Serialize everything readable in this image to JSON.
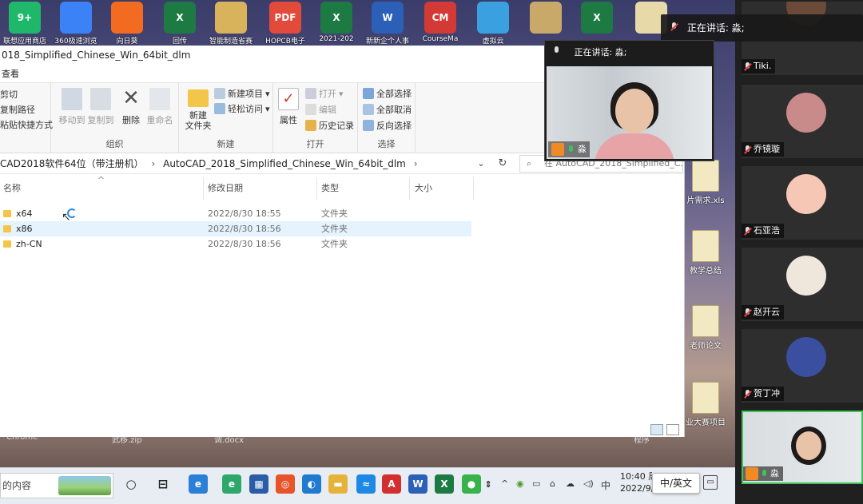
{
  "desktop_icons": [
    {
      "label": "联想应用商店",
      "color": "#1fb86a",
      "glyph": "9+"
    },
    {
      "label": "360极速浏览",
      "color": "#3b82f6",
      "glyph": ""
    },
    {
      "label": "向日葵",
      "color": "#f26b21",
      "glyph": ""
    },
    {
      "label": "回传",
      "color": "#1d7a43",
      "glyph": "X"
    },
    {
      "label": "智能制造省赛",
      "color": "#d9b25c",
      "glyph": ""
    },
    {
      "label": "HOPCB电子",
      "color": "#e24a3b",
      "glyph": "PDF"
    },
    {
      "label": "2021-202",
      "color": "#1d7a43",
      "glyph": "X"
    },
    {
      "label": "新新企个人事",
      "color": "#2b5fb8",
      "glyph": "W"
    },
    {
      "label": "CourseMa",
      "color": "#d33a36",
      "glyph": "CM"
    },
    {
      "label": "虚拟云",
      "color": "#3aa0e0",
      "glyph": ""
    },
    {
      "label": "",
      "color": "#c9a96a",
      "glyph": ""
    },
    {
      "label": "",
      "color": "#1d7a43",
      "glyph": "X"
    },
    {
      "label": "",
      "color": "#e8d9a8",
      "glyph": ""
    }
  ],
  "side_icons": [
    {
      "label": "片需求.xls"
    },
    {
      "label": "教学总结"
    },
    {
      "label": "老师论文"
    },
    {
      "label": "业大赛项目"
    }
  ],
  "desktop_bottom_labels": [
    "Chrome",
    "武移.zip",
    "调.docx",
    "程序"
  ],
  "explorer": {
    "title": "018_Simplified_Chinese_Win_64bit_dlm",
    "menu": "查看",
    "ribbon": {
      "clipboard_items": [
        "剪切",
        "复制路径",
        "粘贴快捷方式"
      ],
      "organize": {
        "label": "组织",
        "move_to": "移动到",
        "copy_to": "复制到",
        "delete": "删除",
        "rename": "重命名"
      },
      "new": {
        "label": "新建",
        "new_item": "新建项目",
        "easy_access": "轻松访问",
        "new_folder": "新建\n文件夹"
      },
      "open": {
        "label": "打开",
        "properties": "属性",
        "open": "打开",
        "edit": "编辑",
        "history": "历史记录"
      },
      "select": {
        "label": "选择",
        "select_all": "全部选择",
        "select_none": "全部取消",
        "invert": "反向选择"
      }
    },
    "address": {
      "crumb1": "CAD2018软件64位（带注册机）",
      "crumb2": "AutoCAD_2018_Simplified_Chinese_Win_64bit_dlm",
      "search_placeholder": "在 AutoCAD_2018_Simplified_C..."
    },
    "columns": {
      "name": "名称",
      "date": "修改日期",
      "type": "类型",
      "size": "大小"
    },
    "rows": [
      {
        "name": "x64",
        "date": "2022/8/30 18:55",
        "type": "文件夹"
      },
      {
        "name": "x86",
        "date": "2022/8/30 18:56",
        "type": "文件夹"
      },
      {
        "name": "zh-CN",
        "date": "2022/8/30 18:56",
        "type": "文件夹"
      }
    ]
  },
  "taskbar": {
    "search_text": "的内容",
    "clock_time": "10:40 周",
    "clock_date": "2022/9/",
    "ime": "中",
    "ime_popup": "中/英文"
  },
  "meeting": {
    "speaking_banner": "正在讲话: 淼;",
    "video_header": "正在讲话: 淼;",
    "video_name": "淼",
    "participants": [
      {
        "name": "Tiki.",
        "avatar_color": "#6b4a3a"
      },
      {
        "name": "乔镜璇",
        "avatar_color": "#c98a8a"
      },
      {
        "name": "石亚浩",
        "avatar_color": "#f7c7b6"
      },
      {
        "name": "赵开云",
        "avatar_color": "#efe6dc"
      },
      {
        "name": "贺丁冲",
        "avatar_color": "#3a4fa0"
      },
      {
        "name": "淼",
        "avatar_color": "#e8c3a8"
      }
    ]
  }
}
